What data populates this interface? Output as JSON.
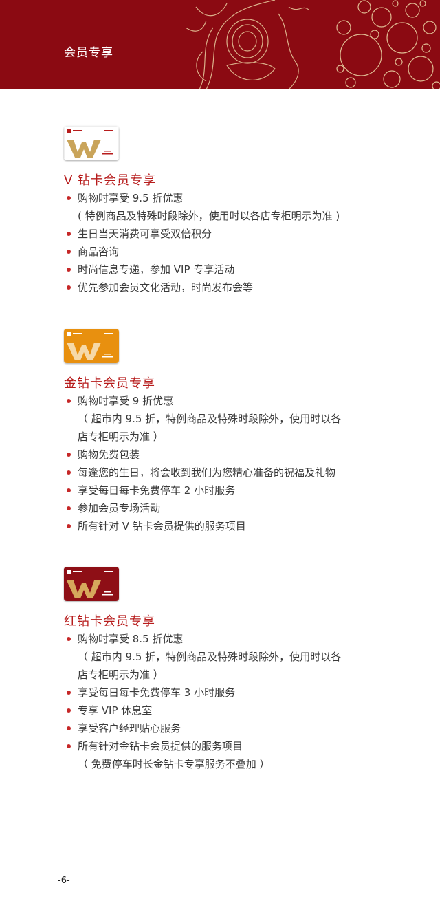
{
  "header": {
    "title": "会员专享",
    "background": "#8b0a12"
  },
  "sections": [
    {
      "card": {
        "icon": "v-diamond-card-image",
        "color": "#ffffff",
        "brand": "王府井百货",
        "level": "V钻卡"
      },
      "title": "V 钻卡会员专享",
      "items": [
        "购物时享受 9.5 折优惠\n( 特例商品及特殊时段除外，使用时以各店专柜明示为准 )",
        "生日当天消费可享受双倍积分",
        "商品咨询",
        "时尚信息专递，参加 VIP 专享活动",
        "优先参加会员文化活动，时尚发布会等"
      ]
    },
    {
      "card": {
        "icon": "gold-diamond-card-image",
        "color": "#e8900f",
        "brand": "王府井百货",
        "level": "金钻卡"
      },
      "title": "金钻卡会员专享",
      "items": [
        "购物时享受 9 折优惠\n （ 超市内 9.5 折，特例商品及特殊时段除外，使用时以各\n店专柜明示为准 ）",
        "购物免费包装",
        "每逢您的生日，将会收到我们为您精心准备的祝福及礼物",
        "享受每日每卡免费停车 2 小时服务",
        "参加会员专场活动",
        "所有针对 V 钻卡会员提供的服务项目"
      ]
    },
    {
      "card": {
        "icon": "red-diamond-card-image",
        "color": "#8e0f16",
        "brand": "王府井百货",
        "level": "红钻卡"
      },
      "title": "红钻卡会员专享",
      "items": [
        "购物时享受 8.5 折优惠\n （ 超市内 9.5 折，特例商品及特殊时段除外，使用时以各\n店专柜明示为准 ）",
        "享受每日每卡免费停车 3 小时服务",
        "专享 VIP 休息室",
        "享受客户经理贴心服务",
        "所有针对金钻卡会员提供的服务项目\n （ 免费停车时长金钻卡专享服务不叠加 ）"
      ]
    }
  ],
  "footer": {
    "page_number": "-6-"
  }
}
